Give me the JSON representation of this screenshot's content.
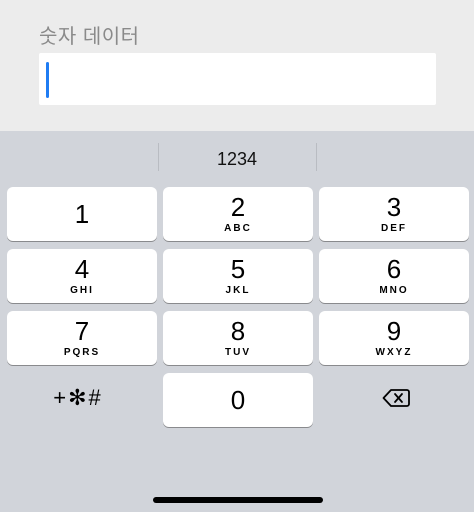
{
  "field": {
    "label": "숫자 데이터",
    "value": ""
  },
  "suggestion": "1234",
  "keys": [
    {
      "num": "1",
      "letters": ""
    },
    {
      "num": "2",
      "letters": "ABC"
    },
    {
      "num": "3",
      "letters": "DEF"
    },
    {
      "num": "4",
      "letters": "GHI"
    },
    {
      "num": "5",
      "letters": "JKL"
    },
    {
      "num": "6",
      "letters": "MNO"
    },
    {
      "num": "7",
      "letters": "PQRS"
    },
    {
      "num": "8",
      "letters": "TUV"
    },
    {
      "num": "9",
      "letters": "WXYZ"
    },
    {
      "num": "0",
      "letters": ""
    }
  ],
  "symbols_key": "+✻#",
  "delete_icon": "backspace-icon",
  "accent_color": "#1f7cf3"
}
